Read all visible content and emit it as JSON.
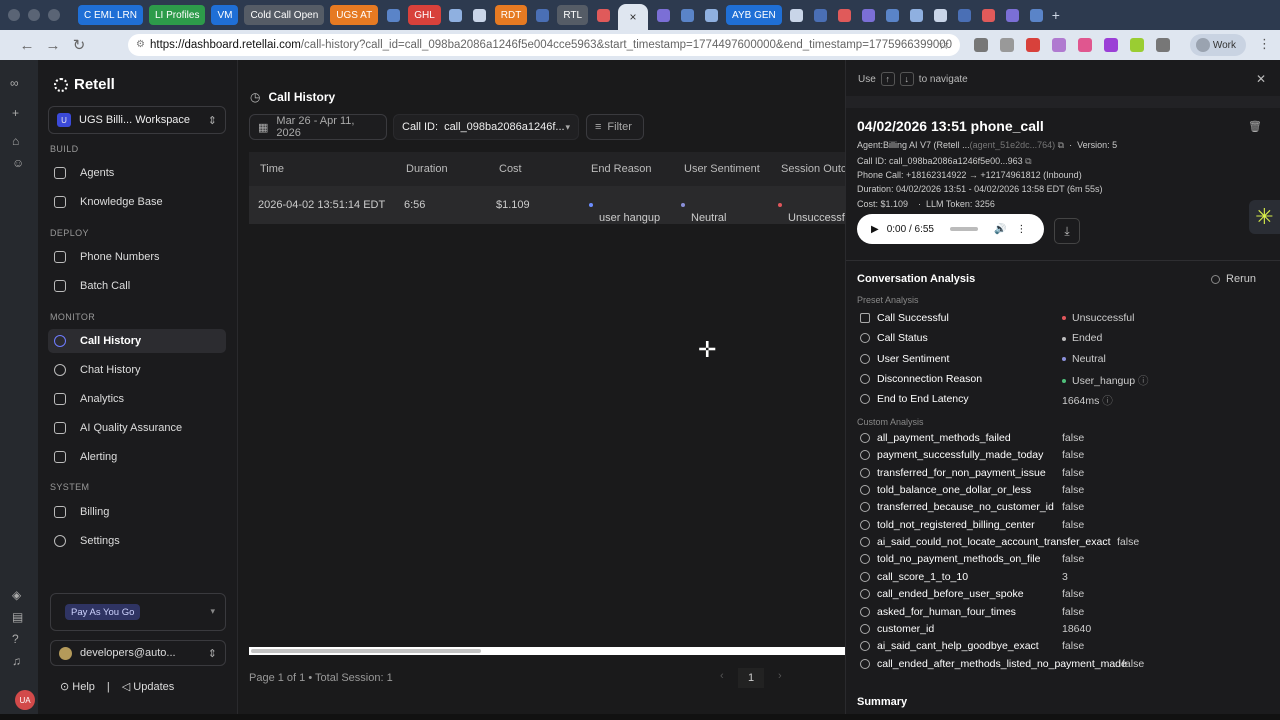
{
  "browser": {
    "tabs": [
      {
        "label": "C EML LRN",
        "color": "#1f6fd6"
      },
      {
        "label": "LI Profiles",
        "color": "#2d9b4a"
      },
      {
        "label": "VM",
        "color": "#1f6fd6"
      },
      {
        "label": "Cold Call Open",
        "color": "#555c66"
      },
      {
        "label": "UGS AT",
        "color": "#e67a22"
      },
      {
        "label": "GHL",
        "color": "#d8413b"
      },
      {
        "label": "RDT",
        "color": "#e67a22"
      },
      {
        "label": "RTL",
        "color": "#555c66"
      },
      {
        "label": "AYB GEN",
        "color": "#1f6fd6"
      }
    ],
    "active_tab_close": "×",
    "new_tab": "+",
    "url_host": "https://dashboard.retellai.com",
    "url_rest": "/call-history?call_id=call_098ba2086a1246f5e004cce5963&start_timestamp=1774497600000&end_timestamp=1775966399000",
    "profile_label": "Work"
  },
  "app": {
    "logo": "Retell",
    "workspace": {
      "badge": "U",
      "name": "UGS Billi... Workspace"
    },
    "sections": {
      "build": "BUILD",
      "deploy": "DEPLOY",
      "monitor": "MONITOR",
      "system": "SYSTEM"
    },
    "nav": {
      "agents": "Agents",
      "knowledge_base": "Knowledge Base",
      "phone_numbers": "Phone Numbers",
      "batch_call": "Batch Call",
      "call_history": "Call History",
      "chat_history": "Chat History",
      "analytics": "Analytics",
      "ai_qa": "AI Quality Assurance",
      "alerting": "Alerting",
      "billing": "Billing",
      "settings": "Settings"
    },
    "plan": "Pay As You Go",
    "user_email": "developers@auto...",
    "footer": {
      "help": "Help",
      "sep": "|",
      "updates": "Updates"
    }
  },
  "main": {
    "title": "Call History",
    "date_range": "Mar 26 - Apr 11, 2026",
    "call_id_label": "Call ID:",
    "call_id_value": "call_098ba2086a1246f...",
    "filter": "Filter",
    "columns": [
      "Time",
      "Duration",
      "Cost",
      "End Reason",
      "User Sentiment",
      "Session Outc"
    ],
    "row": {
      "time": "2026-04-02 13:51:14 EDT",
      "duration": "6:56",
      "cost": "$1.109",
      "end_reason": "user hangup",
      "sentiment": "Neutral",
      "outcome": "Unsuccessf"
    },
    "pager": "Page 1 of 1 • Total Session: 1",
    "page_number": "1"
  },
  "panel": {
    "hint_use": "Use",
    "hint_navigate": "to navigate",
    "title": "04/02/2026 13:51 phone_call",
    "agent_label": "Agent:",
    "agent": "Billing AI V7 (Retell ...",
    "agent_id": "(agent_51e2dc...764)",
    "version": "Version: 5",
    "call_id": "Call ID: call_098ba2086a1246f5e00...963",
    "phone_call": "Phone Call: +18162314922 → +12174961812 (Inbound)",
    "duration": "Duration: 04/02/2026 13:51 - 04/02/2026 13:58 EDT (6m 55s)",
    "cost": "Cost: $1.109",
    "llm_token": "LLM Token: 3256",
    "audio_time": "0:00 / 6:55",
    "conversation_analysis": "Conversation Analysis",
    "rerun": "Rerun",
    "preset_label": "Preset Analysis",
    "preset": [
      {
        "key": "Call Successful",
        "value": "Unsuccessful",
        "dot": "#e0565b"
      },
      {
        "key": "Call Status",
        "value": "Ended",
        "dot": "#bbbbbb"
      },
      {
        "key": "User Sentiment",
        "value": "Neutral",
        "dot": "#8a8fd8"
      },
      {
        "key": "Disconnection Reason",
        "value": "User_hangup",
        "dot": "#4fc07a"
      },
      {
        "key": "End to End Latency",
        "value": "1664ms",
        "dot": ""
      }
    ],
    "custom_label": "Custom Analysis",
    "custom": [
      {
        "key": "all_payment_methods_failed",
        "value": "false"
      },
      {
        "key": "payment_successfully_made_today",
        "value": "false"
      },
      {
        "key": "transferred_for_non_payment_issue",
        "value": "false"
      },
      {
        "key": "told_balance_one_dollar_or_less",
        "value": "false"
      },
      {
        "key": "transferred_because_no_customer_id",
        "value": "false"
      },
      {
        "key": "told_not_registered_billing_center",
        "value": "false"
      },
      {
        "key": "ai_said_could_not_locate_account_transfer_exact",
        "value": "false"
      },
      {
        "key": "told_no_payment_methods_on_file",
        "value": "false"
      },
      {
        "key": "call_score_1_to_10",
        "value": "3"
      },
      {
        "key": "call_ended_before_user_spoke",
        "value": "false"
      },
      {
        "key": "asked_for_human_four_times",
        "value": "false"
      },
      {
        "key": "customer_id",
        "value": "18640"
      },
      {
        "key": "ai_said_cant_help_goodbye_exact",
        "value": "false"
      },
      {
        "key": "call_ended_after_methods_listed_no_payment_made",
        "value": "false"
      }
    ],
    "summary": "Summary"
  },
  "rail": {
    "avatar": "UA"
  }
}
